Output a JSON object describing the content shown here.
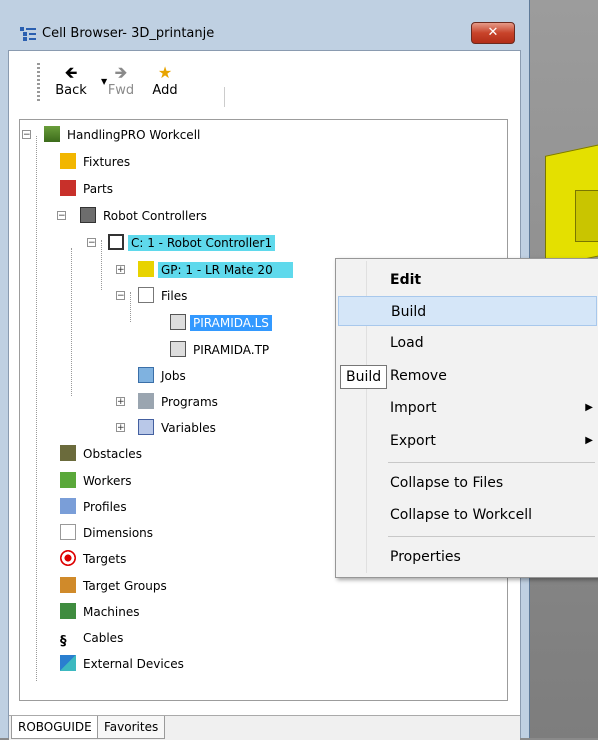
{
  "window": {
    "title": "Cell Browser- 3D_printanje",
    "close_label": "✕"
  },
  "toolbar": {
    "back_label": "Back",
    "fwd_label": "Fwd",
    "add_label": "Add"
  },
  "tree": {
    "root": "HandlingPRO Workcell",
    "fixtures": "Fixtures",
    "parts": "Parts",
    "robot_controllers": "Robot Controllers",
    "controller1": "C: 1 - Robot Controller1",
    "gp1": "GP: 1 - LR Mate 20",
    "files": "Files",
    "file_ls": "PIRAMIDA.LS",
    "file_tp": "PIRAMIDA.TP",
    "jobs": "Jobs",
    "programs": "Programs",
    "variables": "Variables",
    "obstacles": "Obstacles",
    "workers": "Workers",
    "profiles": "Profiles",
    "dimensions": "Dimensions",
    "targets": "Targets",
    "target_groups": "Target Groups",
    "machines": "Machines",
    "cables": "Cables",
    "external_devices": "External Devices"
  },
  "tabs": [
    "ROBOGUIDE",
    "Favorites"
  ],
  "context_menu": {
    "items": [
      "Edit",
      "Build",
      "Load",
      "Remove",
      "Import",
      "Export",
      "Collapse to Files",
      "Collapse to Workcell",
      "Properties"
    ],
    "hovered": "Build"
  },
  "tooltip": "Build",
  "colors": {
    "highlight": "#5fd9ec",
    "selection": "#3399ff",
    "menu_hover": "#d5e6f8"
  }
}
